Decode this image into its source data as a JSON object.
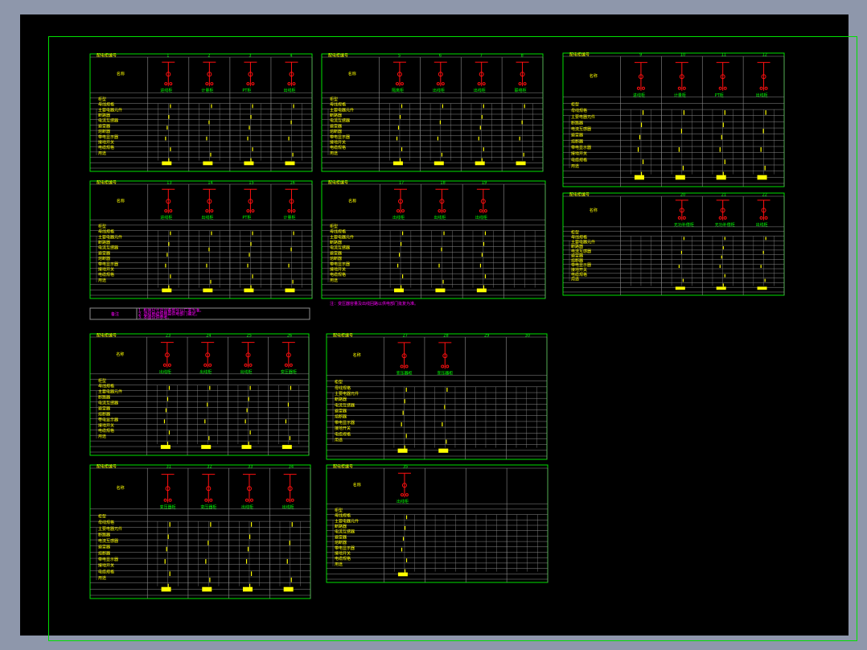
{
  "drawing": {
    "colors": {
      "frame": "#00e000",
      "grid": "#8c8c8c",
      "symbol": "#ff1010",
      "text": "#ffff00",
      "label": "#00ff00",
      "note": "#ff00ff"
    },
    "row_header": "配电柜编号",
    "side_label": "名称",
    "row_labels": [
      "柜型",
      "母线规格",
      "主要电器元件",
      "断路器",
      "电流互感器",
      "避雷器",
      "熔断器",
      "带电显示器",
      "接地开关",
      "电缆规格",
      "用途"
    ],
    "note": {
      "title": "备注",
      "lines": [
        "1. 柜体尺寸及设备型号以厂家为准。",
        "2. 进线电缆规格由供电部门确定。",
        "3. 本图仅供参考。"
      ]
    },
    "note2": "注：变压器容量及出线回路以供电部门批复为准。",
    "panels": [
      {
        "title": "配电柜编号",
        "columns": [
          {
            "no": "1",
            "name": "进线柜"
          },
          {
            "no": "2",
            "name": "计量柜"
          },
          {
            "no": "3",
            "name": "PT柜"
          },
          {
            "no": "4",
            "name": "出线柜"
          }
        ]
      },
      {
        "title": "配电柜编号",
        "columns": [
          {
            "no": "5",
            "name": "隔离柜"
          },
          {
            "no": "6",
            "name": "出线柜"
          },
          {
            "no": "7",
            "name": "出线柜"
          },
          {
            "no": "8",
            "name": "联络柜"
          }
        ]
      },
      {
        "title": "配电柜编号",
        "columns": [
          {
            "no": "9",
            "name": "进线柜"
          },
          {
            "no": "10",
            "name": "计量柜"
          },
          {
            "no": "11",
            "name": "PT柜"
          },
          {
            "no": "12",
            "name": "出线柜"
          }
        ]
      },
      {
        "title": "配电柜编号",
        "columns": [
          {
            "no": "13",
            "name": "进线柜"
          },
          {
            "no": "14",
            "name": "出线柜"
          },
          {
            "no": "15",
            "name": "PT柜"
          },
          {
            "no": "16",
            "name": "计量柜"
          }
        ]
      },
      {
        "title": "配电柜编号",
        "columns": [
          {
            "no": "17",
            "name": "出线柜"
          },
          {
            "no": "18",
            "name": "出线柜"
          },
          {
            "no": "19",
            "name": "出线柜"
          },
          {
            "no": "",
            "name": ""
          }
        ]
      },
      {
        "title": "配电柜编号",
        "columns": [
          {
            "no": "",
            "name": ""
          },
          {
            "no": "20",
            "name": "无功补偿柜"
          },
          {
            "no": "21",
            "name": "无功补偿柜"
          },
          {
            "no": "22",
            "name": "出线柜"
          }
        ]
      },
      {
        "title": "配电柜编号",
        "columns": [
          {
            "no": "23",
            "name": "出线柜"
          },
          {
            "no": "24",
            "name": "出线柜"
          },
          {
            "no": "25",
            "name": "出线柜"
          },
          {
            "no": "26",
            "name": "变压器柜"
          }
        ]
      },
      {
        "title": "配电柜编号",
        "columns": [
          {
            "no": "27",
            "name": "变压器柜"
          },
          {
            "no": "28",
            "name": "变压器柜"
          },
          {
            "no": "29",
            "name": ""
          },
          {
            "no": "30",
            "name": ""
          }
        ]
      },
      {
        "title": "配电柜编号",
        "columns": [
          {
            "no": "31",
            "name": "变压器柜"
          },
          {
            "no": "32",
            "name": "变压器柜"
          },
          {
            "no": "33",
            "name": "出线柜"
          },
          {
            "no": "34",
            "name": "出线柜"
          }
        ]
      },
      {
        "title": "配电柜编号",
        "columns": [
          {
            "no": "35",
            "name": "出线柜"
          },
          {
            "no": "",
            "name": ""
          },
          {
            "no": "",
            "name": ""
          },
          {
            "no": "",
            "name": ""
          }
        ]
      }
    ]
  }
}
